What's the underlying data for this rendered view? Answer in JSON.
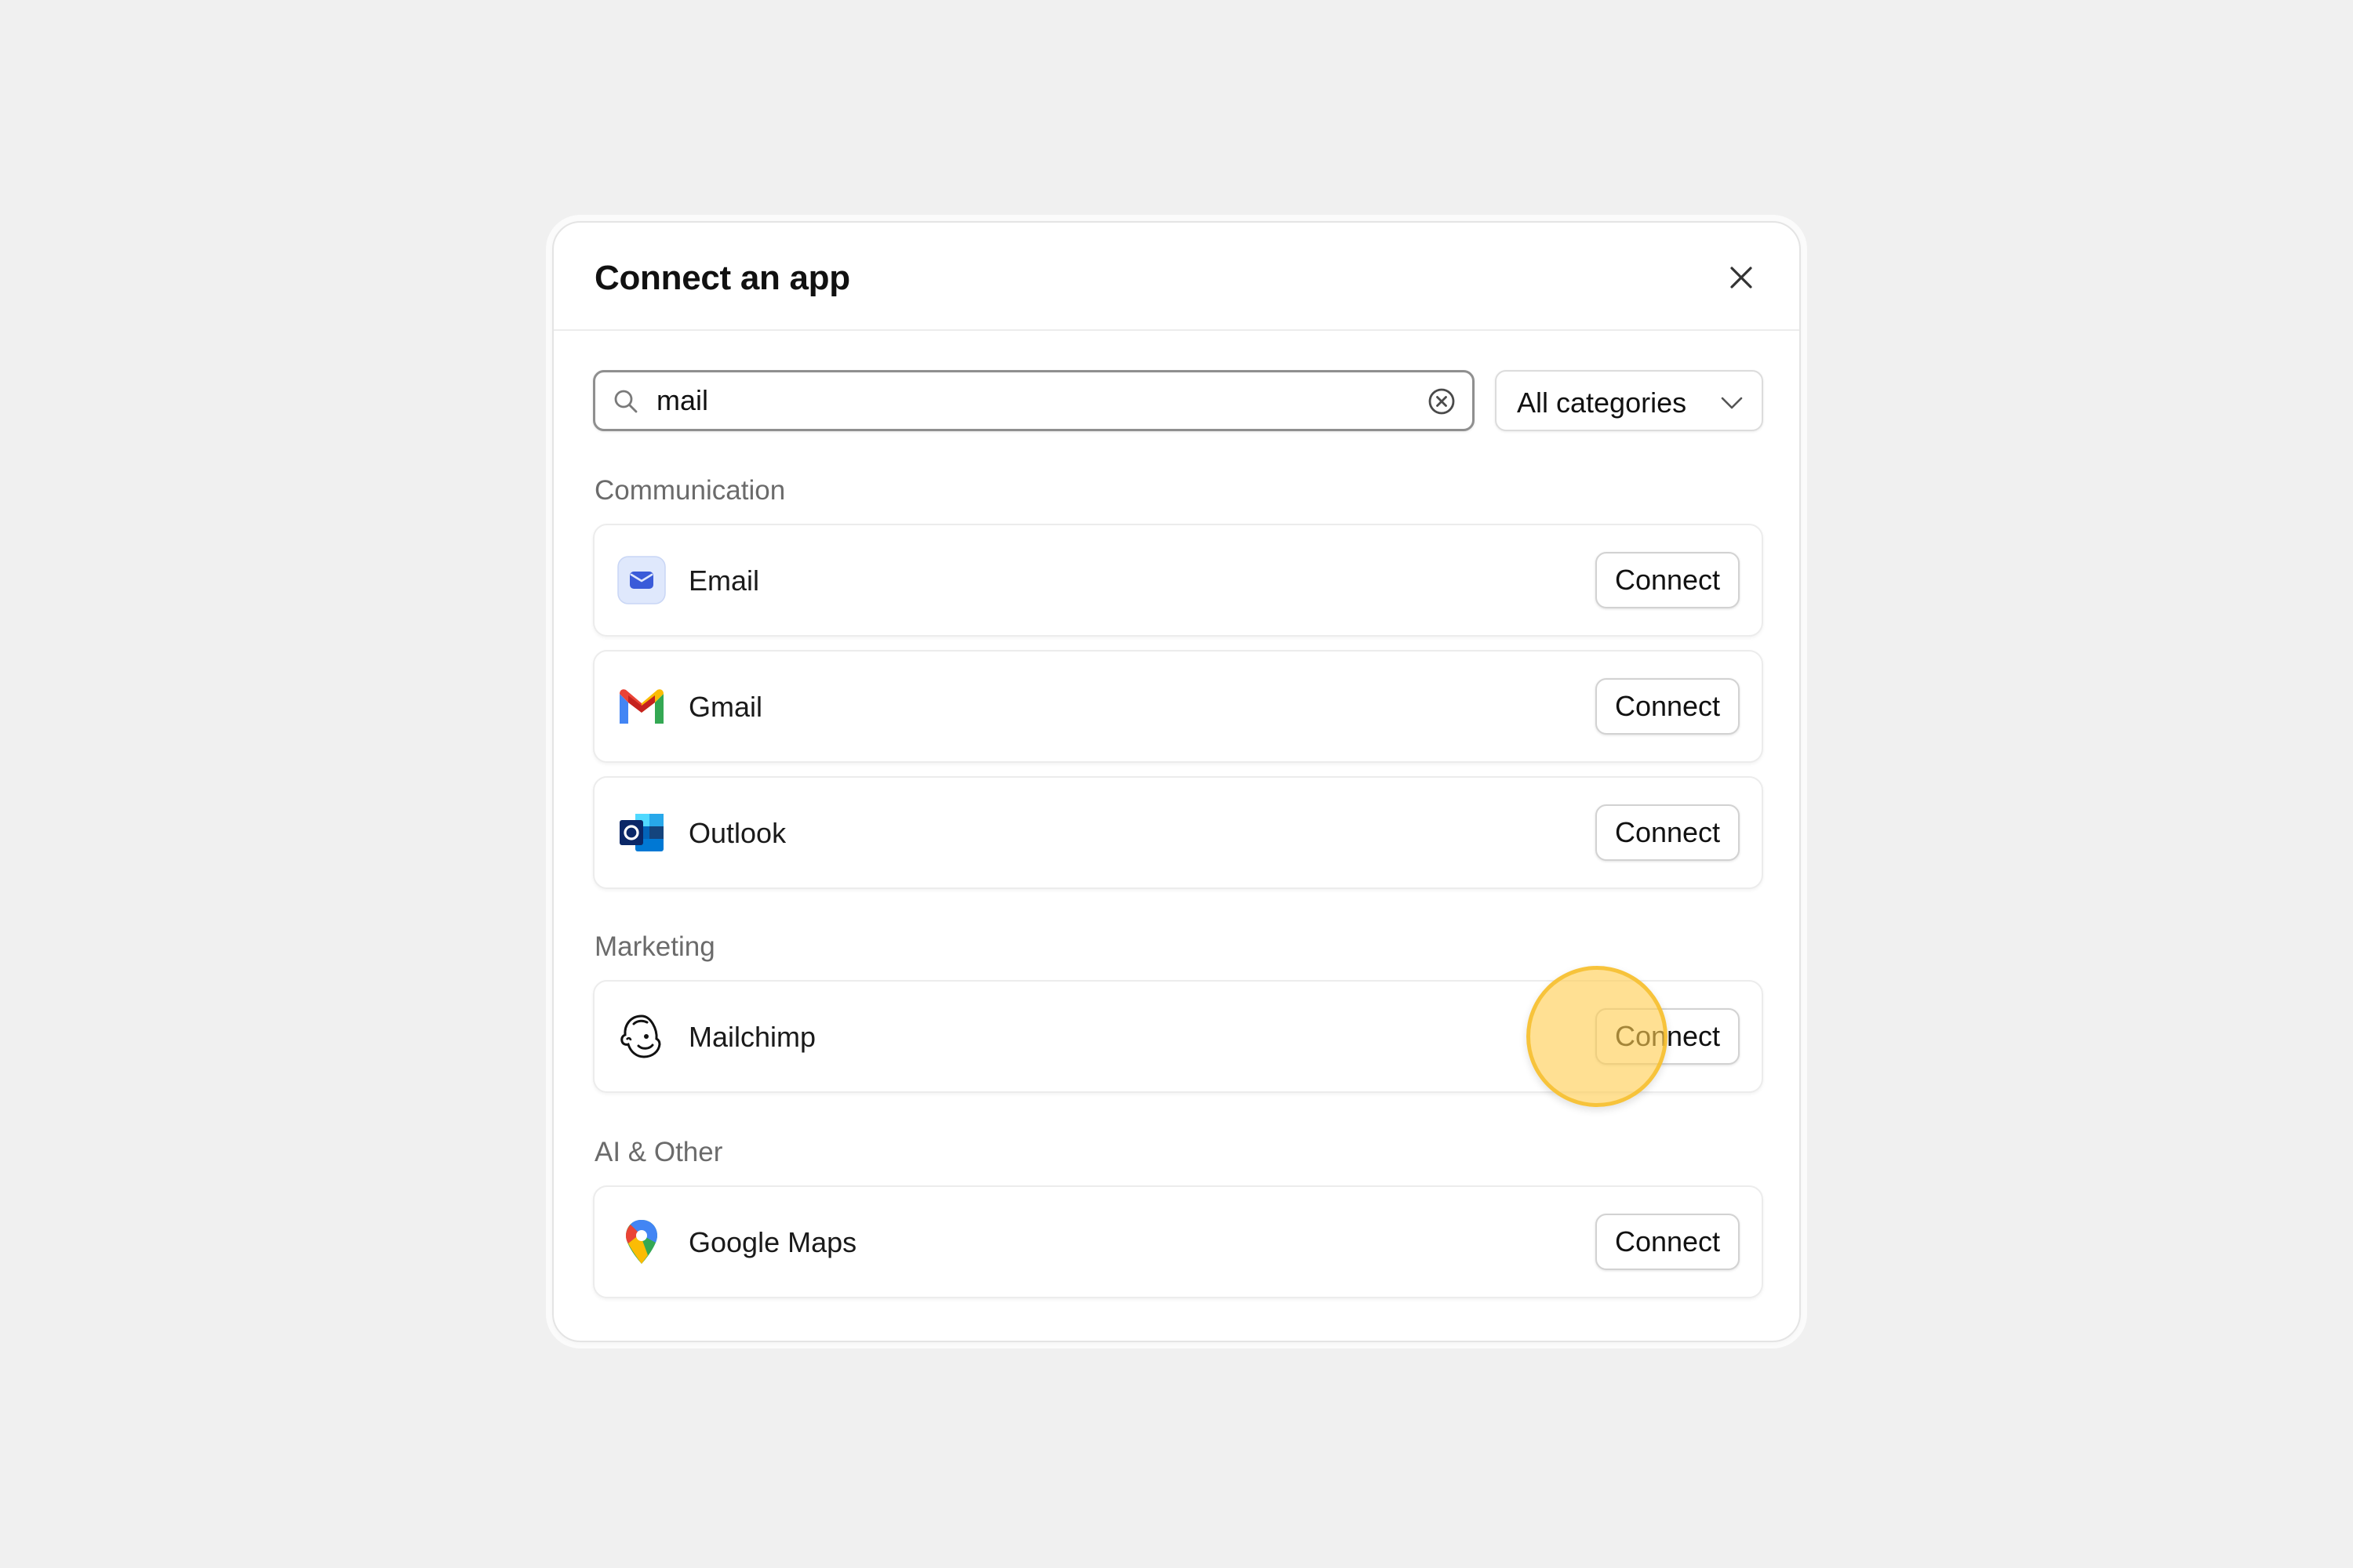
{
  "modal": {
    "title": "Connect an app",
    "close_icon": "close-icon"
  },
  "search": {
    "value": "mail",
    "placeholder": "",
    "search_icon": "search-icon",
    "clear_icon": "clear-circle-icon"
  },
  "category_filter": {
    "selected": "All categories",
    "icon": "chevron-down-icon"
  },
  "sections": [
    {
      "label": "Communication",
      "apps": [
        {
          "name": "Email",
          "icon": "email-app-icon",
          "action": "Connect"
        },
        {
          "name": "Gmail",
          "icon": "gmail-icon",
          "action": "Connect"
        },
        {
          "name": "Outlook",
          "icon": "outlook-icon",
          "action": "Connect"
        }
      ]
    },
    {
      "label": "Marketing",
      "apps": [
        {
          "name": "Mailchimp",
          "icon": "mailchimp-icon",
          "action": "Connect"
        }
      ]
    },
    {
      "label": "AI & Other",
      "apps": [
        {
          "name": "Google Maps",
          "icon": "google-maps-icon",
          "action": "Connect"
        }
      ]
    }
  ],
  "colors": {
    "background": "#f0f0f0",
    "email_icon_bg": "#dfe8fc",
    "email_icon_fg": "#3a5bd9",
    "cursor_highlight": "#ffcd50"
  }
}
